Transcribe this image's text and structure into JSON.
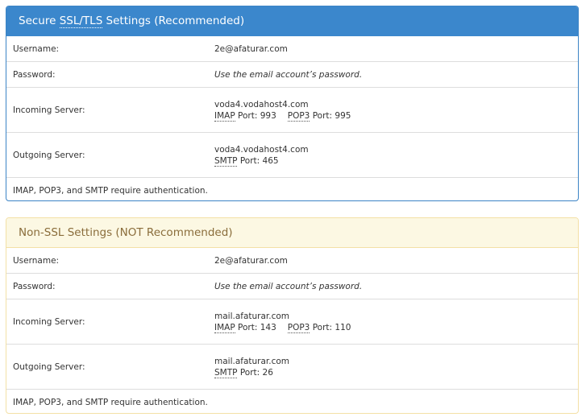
{
  "secure": {
    "heading_pre": "Secure ",
    "heading_abbr": "SSL/TLS",
    "heading_post": " Settings (Recommended)",
    "username_label": "Username:",
    "username_value": "2e@afaturar.com",
    "password_label": "Password:",
    "password_value": "Use the email account’s password.",
    "incoming_label": "Incoming Server:",
    "incoming_host": "voda4.vodahost4.com",
    "imap_abbr": "IMAP",
    "imap_port_label": " Port: ",
    "imap_port": "993",
    "pop3_abbr": "POP3",
    "pop3_port_label": " Port: ",
    "pop3_port": "995",
    "outgoing_label": "Outgoing Server:",
    "outgoing_host": "voda4.vodahost4.com",
    "smtp_abbr": "SMTP",
    "smtp_port_label": " Port: ",
    "smtp_port": "465",
    "auth_note": "IMAP, POP3, and SMTP require authentication."
  },
  "nonssl": {
    "heading": "Non-SSL Settings (NOT Recommended)",
    "username_label": "Username:",
    "username_value": "2e@afaturar.com",
    "password_label": "Password:",
    "password_value": "Use the email account’s password.",
    "incoming_label": "Incoming Server:",
    "incoming_host": "mail.afaturar.com",
    "imap_abbr": "IMAP",
    "imap_port_label": " Port: ",
    "imap_port": "143",
    "pop3_abbr": "POP3",
    "pop3_port_label": " Port: ",
    "pop3_port": "110",
    "outgoing_label": "Outgoing Server:",
    "outgoing_host": "mail.afaturar.com",
    "smtp_abbr": "SMTP",
    "smtp_port_label": " Port: ",
    "smtp_port": "26",
    "auth_note": "IMAP, POP3, and SMTP require authentication."
  },
  "colors": {
    "secure_heading_bg": "#3b87cc",
    "secure_border": "#3c84c6",
    "nonssl_heading_bg": "#fcf8e3",
    "nonssl_heading_text": "#8a6d3b",
    "nonssl_border": "#f3e0a6"
  }
}
